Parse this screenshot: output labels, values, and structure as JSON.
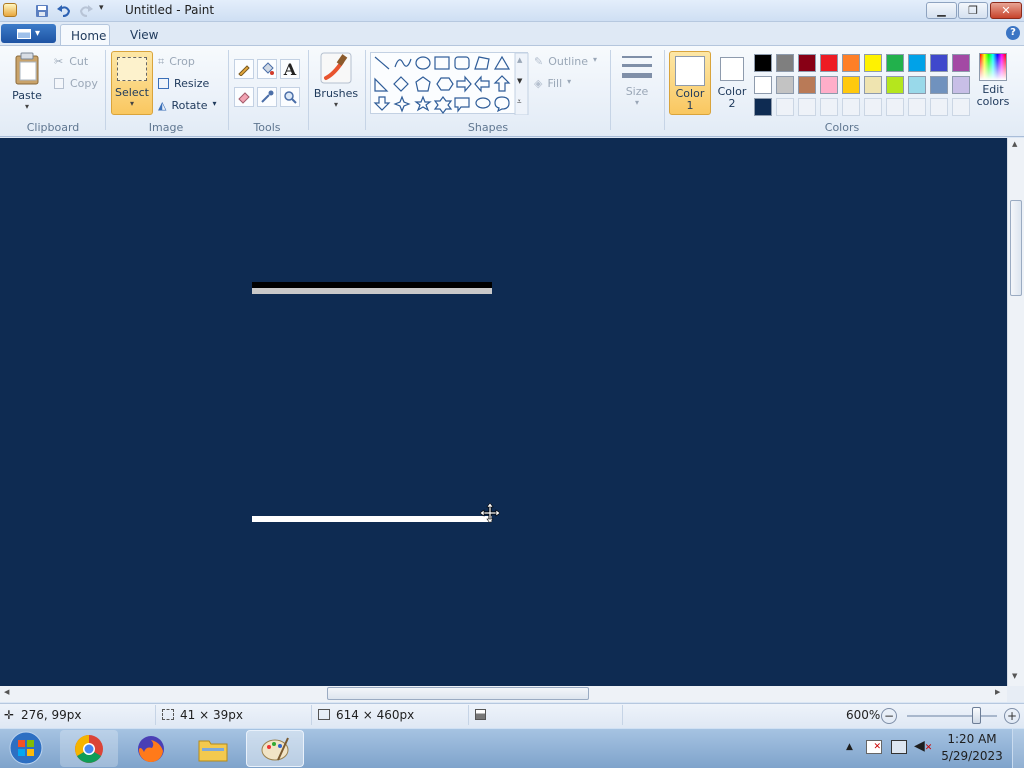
{
  "window": {
    "title": "Untitled - Paint"
  },
  "app_menu_label": "▾",
  "tabs": [
    {
      "label": "Home"
    },
    {
      "label": "View"
    }
  ],
  "help_label": "?",
  "clipboard": {
    "paste": "Paste",
    "cut": "Cut",
    "copy": "Copy",
    "group": "Clipboard"
  },
  "image": {
    "select": "Select",
    "crop": "Crop",
    "resize": "Resize",
    "rotate": "Rotate",
    "group": "Image"
  },
  "tools": {
    "group": "Tools",
    "text_tool": "A"
  },
  "brushes": {
    "label": "Brushes"
  },
  "shapes": {
    "group": "Shapes",
    "outline": "Outline",
    "fill": "Fill"
  },
  "size": {
    "label": "Size"
  },
  "colors": {
    "group": "Colors",
    "color1": [
      "Color",
      "1"
    ],
    "color2": [
      "Color",
      "2"
    ],
    "edit": [
      "Edit",
      "colors"
    ],
    "color1_value": "#ffffff",
    "color2_value": "#ffffff",
    "palette_row1": [
      "#000000",
      "#7f7f7f",
      "#880015",
      "#ed1c24",
      "#ff7f27",
      "#fff200",
      "#22b14c",
      "#00a2e8",
      "#3f48cc",
      "#a349a4"
    ],
    "palette_row2": [
      "#ffffff",
      "#c3c3c3",
      "#b97a57",
      "#ffaec9",
      "#ffc90e",
      "#efe4b0",
      "#b5e61d",
      "#99d9ea",
      "#7092be",
      "#c8bfe7"
    ],
    "palette_row3": [
      "#0e2b52",
      "",
      "",
      "",
      "",
      "",
      "",
      "",
      "",
      ""
    ]
  },
  "canvas": {
    "background": "#0e2b52"
  },
  "status": {
    "cursor_pos": "276, 99px",
    "selection_size": "41 × 39px",
    "image_size": "614 × 460px",
    "zoom": "600%",
    "zoom_minus": "−",
    "zoom_plus": "+"
  },
  "taskbar": {
    "time": "1:20 AM",
    "date": "5/29/2023"
  }
}
